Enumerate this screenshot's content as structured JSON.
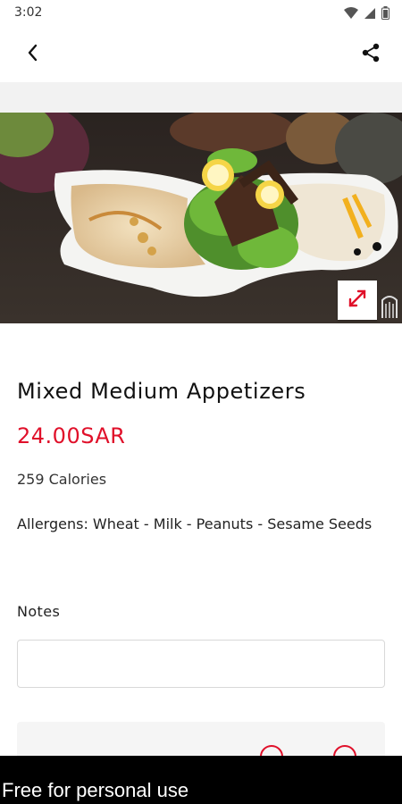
{
  "status": {
    "time": "3:02"
  },
  "product": {
    "name": "Mixed Medium Appetizers",
    "price": "24.00SAR",
    "calories": "259 Calories",
    "allergens": "Allergens: Wheat - Milk - Peanuts - Sesame Seeds"
  },
  "notes": {
    "label": "Notes",
    "value": "",
    "placeholder": ""
  },
  "watermark": "Free for personal use",
  "colors": {
    "accent": "#e0102a"
  },
  "icons": {
    "back": "chevron-left-icon",
    "share": "share-icon",
    "expand": "expand-icon"
  }
}
